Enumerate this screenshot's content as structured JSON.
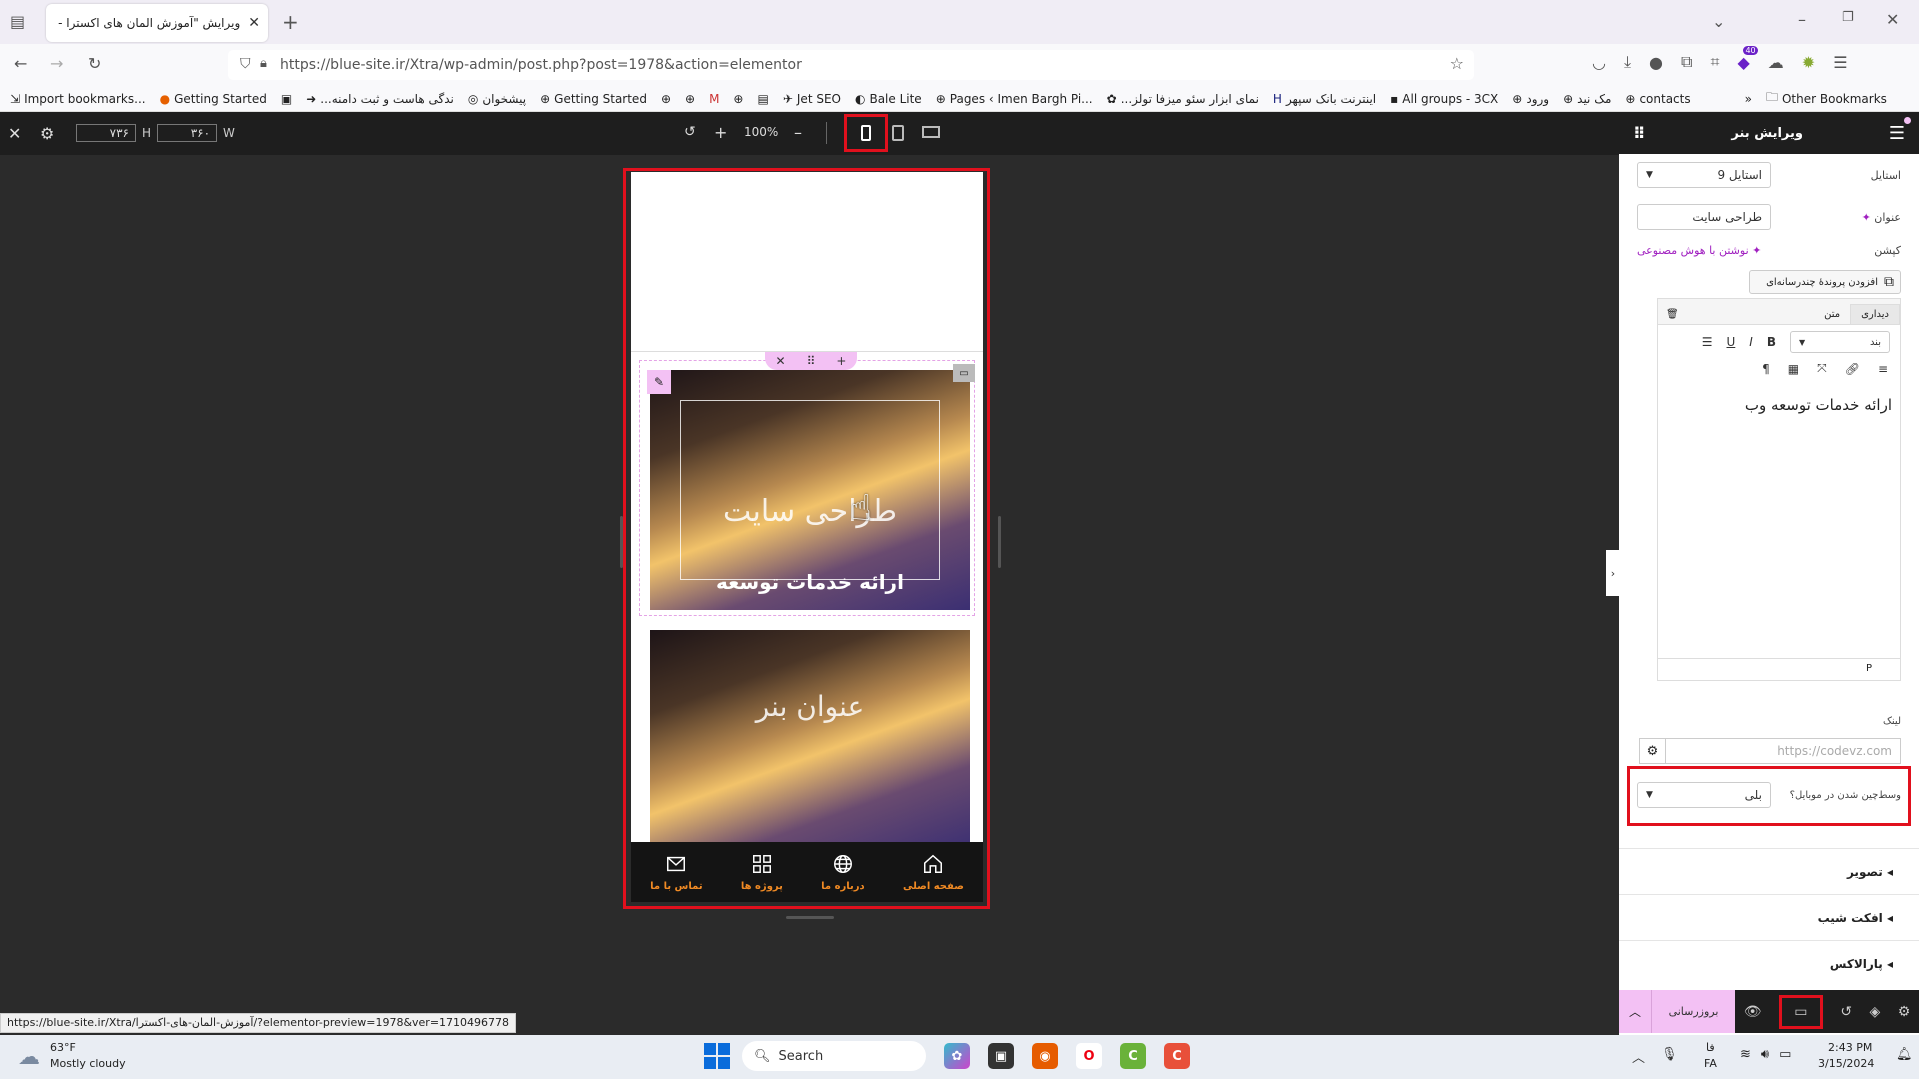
{
  "browser": {
    "tab_title": "ویرایش \"آموزش المان های اکسترا - ...",
    "url": "https://blue-site.ir/Xtra/wp-admin/post.php?post=1978&action=elementor",
    "extension_badge": "40",
    "bookmarks": [
      "Import bookmarks...",
      "Getting Started",
      "...ندگی هاست و ثبت دامنه",
      "پیشخوان",
      "Getting Started",
      "Jet SEO",
      "Bale Lite",
      "Pages ‹ Imen Bargh Pi...",
      "...نمای ابزار سئو میزفا تولز",
      "اینترنت بانک سپهر",
      "All groups - 3CX",
      "ورود",
      "مک نید",
      "contacts"
    ],
    "other_bookmarks": "Other Bookmarks"
  },
  "editor_top": {
    "height_value": "۷۳۶",
    "height_label": "H",
    "width_value": "۳۶۰",
    "width_label": "W",
    "zoom": "100%"
  },
  "preview": {
    "banner1_title": "طراحی سایت",
    "banner1_text": "ارائه خدمات توسعه",
    "banner2_title": "عنوان بنر",
    "nav": [
      {
        "label": "صفحه اصلی",
        "icon": "home-icon"
      },
      {
        "label": "درباره ما",
        "icon": "globe-icon"
      },
      {
        "label": "پروژه ها",
        "icon": "grid-icon"
      },
      {
        "label": "تماس با ما",
        "icon": "mail-icon"
      }
    ]
  },
  "panel": {
    "title": "ویرایش بنر",
    "style_label": "استایل",
    "style_value": "استایل 9",
    "title_label": "عنوان",
    "title_value": "طراحی سایت",
    "caption_label": "کپشن",
    "ai_write": "نوشتن با هوش مصنوعی",
    "add_media": "افزودن پروندهٔ چندرسانه‌ای",
    "tab_visual": "دیداری",
    "tab_text": "متن",
    "paragraph": "بند",
    "editor_content": "ارائه خدمات توسعه وب",
    "editor_path": "P",
    "link_label": "لینک",
    "link_placeholder": "https://codevz.com",
    "mobile_center_label": "وسط‌چین شدن در موبایل؟",
    "mobile_center_value": "بلی",
    "sections": [
      "تصویر",
      "افکت شیب",
      "پارالاکس"
    ],
    "update_button": "بروزرسانی"
  },
  "status_url": "https://blue-site.ir/Xtra/آموزش-المان-های-اکسترا/?elementor-preview=1978&ver=1710496778",
  "taskbar": {
    "weather_temp": "63°F",
    "weather_desc": "Mostly cloudy",
    "search_placeholder": "Search",
    "lang_top": "فا",
    "lang_bottom": "FA",
    "time": "2:43 PM",
    "date": "3/15/2024"
  },
  "colors": {
    "accent": "#e1101d",
    "elementor_pink": "#f3c1f4",
    "nav_orange": "#f08a24"
  }
}
